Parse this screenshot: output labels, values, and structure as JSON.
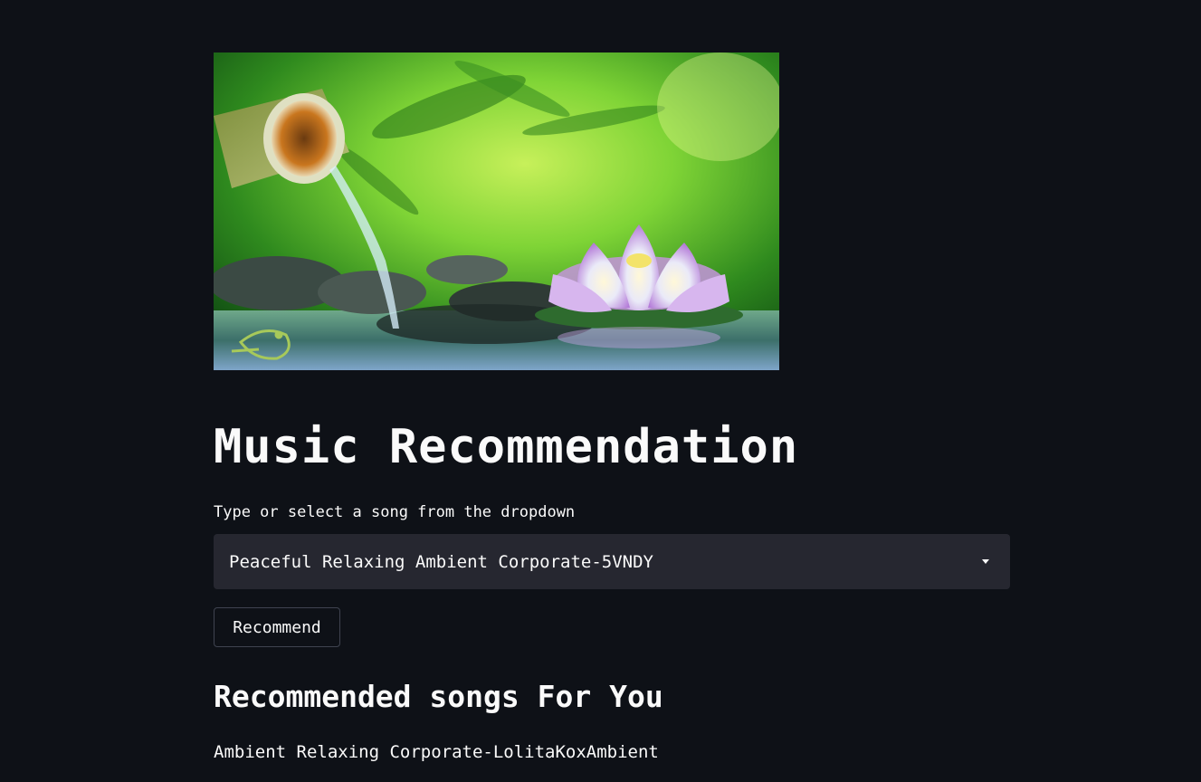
{
  "hero_image": {
    "description_icon": "zen-bamboo-lotus-image"
  },
  "header": {
    "title": "Music Recommendation"
  },
  "song_select": {
    "label": "Type or select a song from the dropdown",
    "selected_value": "Peaceful Relaxing Ambient Corporate-5VNDY"
  },
  "actions": {
    "recommend_label": "Recommend"
  },
  "results": {
    "heading": "Recommended songs For You",
    "items": [
      "Ambient Relaxing Corporate-LolitaKoxAmbient"
    ]
  },
  "colors": {
    "background": "#0e1117",
    "text": "#fafafa",
    "select_bg": "#262730",
    "button_border": "#3f4350"
  }
}
